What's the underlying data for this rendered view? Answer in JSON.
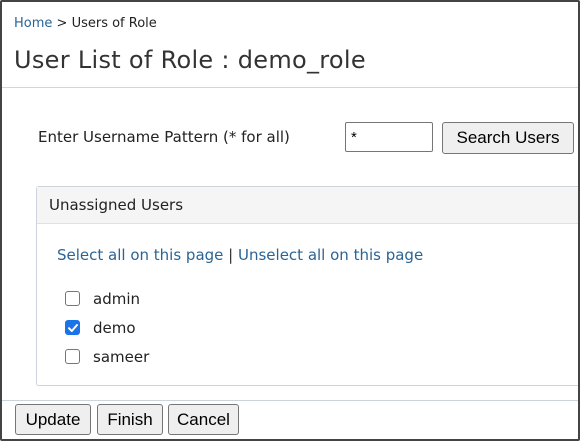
{
  "breadcrumb": {
    "home": "Home",
    "separator": " > ",
    "current": "Users of Role"
  },
  "page_title": "User List of Role : demo_role",
  "search": {
    "label": "Enter Username Pattern (* for all)",
    "value": "*",
    "button_label": "Search Users"
  },
  "panel": {
    "title": "Unassigned Users",
    "select_all": "Select all on this page",
    "separator": " | ",
    "unselect_all": "Unselect all on this page",
    "users": [
      {
        "name": "admin",
        "checked": false
      },
      {
        "name": "demo",
        "checked": true
      },
      {
        "name": "sameer",
        "checked": false
      }
    ]
  },
  "buttons": {
    "update": "Update",
    "finish": "Finish",
    "cancel": "Cancel"
  },
  "colors": {
    "link": "#2a6496",
    "checkbox_checked": "#1a73e8"
  }
}
